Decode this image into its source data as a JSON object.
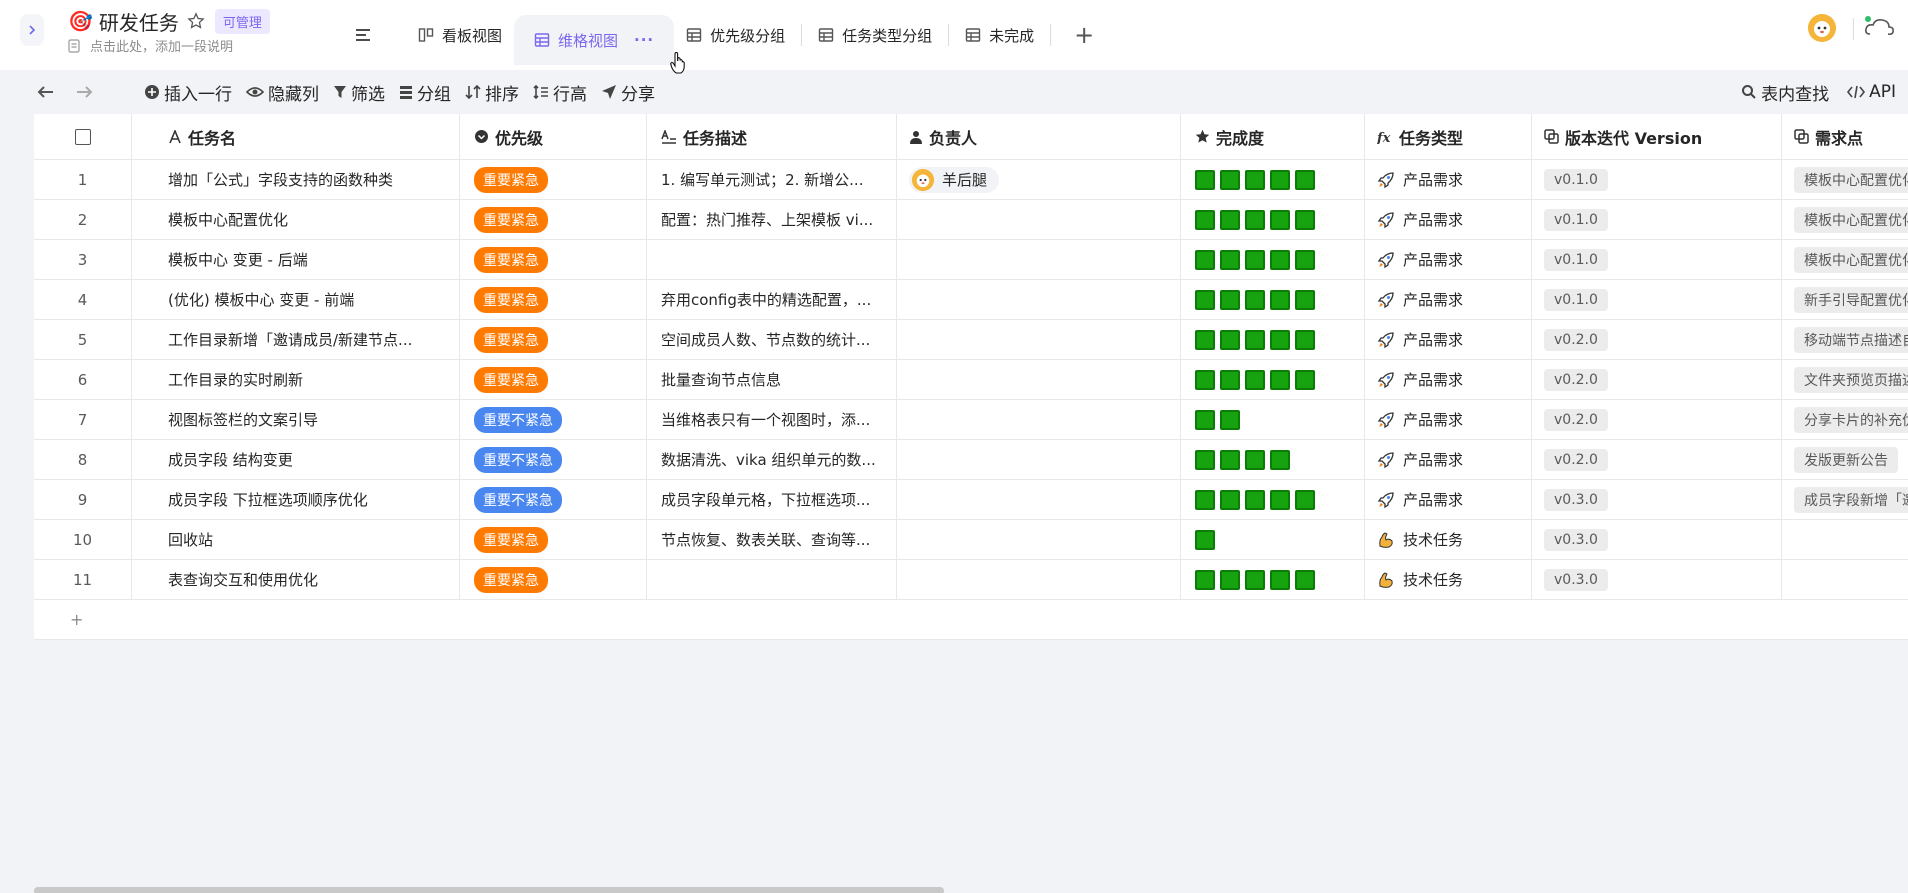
{
  "header": {
    "title_emoji": "🎯",
    "title": "研发任务",
    "permission_badge": "可管理",
    "description_placeholder": "点击此处，添加一段说明",
    "expand_icon": "chevron-right-icon"
  },
  "tabs": [
    {
      "label": "看板视图",
      "icon": "kanban-icon",
      "active": false
    },
    {
      "label": "维格视图",
      "icon": "grid-icon",
      "active": true,
      "more": "···"
    },
    {
      "label": "优先级分组",
      "icon": "grid-icon",
      "active": false
    },
    {
      "label": "任务类型分组",
      "icon": "grid-icon",
      "active": false
    },
    {
      "label": "未完成",
      "icon": "grid-icon",
      "active": false
    }
  ],
  "add_tab": "+",
  "toolbar": {
    "insert_row": "插入一行",
    "hide_columns": "隐藏列",
    "filter": "筛选",
    "group": "分组",
    "sort": "排序",
    "row_height": "行高",
    "share": "分享",
    "search": "表内查找",
    "api": "API"
  },
  "columns": {
    "name": "任务名",
    "priority": "优先级",
    "description": "任务描述",
    "owner": "负责人",
    "completion": "完成度",
    "task_type": "任务类型",
    "version": "版本迭代 Version",
    "requirement": "需求点"
  },
  "rows": [
    {
      "index": "1",
      "name": "增加「公式」字段支持的函数种类",
      "priority": "重要紧急",
      "priority_color": "orange",
      "description": "1. 编写单元测试；2. 新增公...",
      "owner": "羊后腿",
      "completion": 5,
      "type": "产品需求",
      "type_icon": "rocket-icon",
      "version": "v0.1.0",
      "requirement": "模板中心配置优化"
    },
    {
      "index": "2",
      "name": "模板中心配置优化",
      "priority": "重要紧急",
      "priority_color": "orange",
      "description": "配置：热门推荐、上架模板 vi...",
      "owner": "",
      "completion": 5,
      "type": "产品需求",
      "type_icon": "rocket-icon",
      "version": "v0.1.0",
      "requirement": "模板中心配置优化"
    },
    {
      "index": "3",
      "name": "模板中心 变更 - 后端",
      "priority": "重要紧急",
      "priority_color": "orange",
      "description": "",
      "owner": "",
      "completion": 5,
      "type": "产品需求",
      "type_icon": "rocket-icon",
      "version": "v0.1.0",
      "requirement": "模板中心配置优化"
    },
    {
      "index": "4",
      "name": "(优化) 模板中心 变更 - 前端",
      "priority": "重要紧急",
      "priority_color": "orange",
      "description": "弃用config表中的精选配置，...",
      "owner": "",
      "completion": 5,
      "type": "产品需求",
      "type_icon": "rocket-icon",
      "version": "v0.1.0",
      "requirement": "新手引导配置优化"
    },
    {
      "index": "5",
      "name": "工作目录新增「邀请成员/新建节点...",
      "priority": "重要紧急",
      "priority_color": "orange",
      "description": "空间成员人数、节点数的统计...",
      "owner": "",
      "completion": 5,
      "type": "产品需求",
      "type_icon": "rocket-icon",
      "version": "v0.2.0",
      "requirement": "移动端节点描述自动"
    },
    {
      "index": "6",
      "name": "工作目录的实时刷新",
      "priority": "重要紧急",
      "priority_color": "orange",
      "description": "批量查询节点信息",
      "owner": "",
      "completion": 5,
      "type": "产品需求",
      "type_icon": "rocket-icon",
      "version": "v0.2.0",
      "requirement": "文件夹预览页描述模"
    },
    {
      "index": "7",
      "name": "视图标签栏的文案引导",
      "priority": "重要不紧急",
      "priority_color": "blue",
      "description": "当维格表只有一个视图时，添...",
      "owner": "",
      "completion": 2,
      "type": "产品需求",
      "type_icon": "rocket-icon",
      "version": "v0.2.0",
      "requirement": "分享卡片的补充优化"
    },
    {
      "index": "8",
      "name": "成员字段 结构变更",
      "priority": "重要不紧急",
      "priority_color": "blue",
      "description": "数据清洗、vika 组织单元的数...",
      "owner": "",
      "completion": 4,
      "type": "产品需求",
      "type_icon": "rocket-icon",
      "version": "v0.2.0",
      "requirement": "发版更新公告"
    },
    {
      "index": "9",
      "name": "成员字段 下拉框选项顺序优化",
      "priority": "重要不紧急",
      "priority_color": "blue",
      "description": "成员字段单元格，下拉框选项...",
      "owner": "",
      "completion": 5,
      "type": "产品需求",
      "type_icon": "rocket-icon",
      "version": "v0.3.0",
      "requirement": "成员字段新增「邀请"
    },
    {
      "index": "10",
      "name": "回收站",
      "priority": "重要紧急",
      "priority_color": "orange",
      "description": "节点恢复、数表关联、查询等...",
      "owner": "",
      "completion": 1,
      "type": "技术任务",
      "type_icon": "muscle-icon",
      "version": "v0.3.0",
      "requirement": ""
    },
    {
      "index": "11",
      "name": "表查询交互和使用优化",
      "priority": "重要紧急",
      "priority_color": "orange",
      "description": "",
      "owner": "",
      "completion": 5,
      "type": "技术任务",
      "type_icon": "muscle-icon",
      "version": "v0.3.0",
      "requirement": ""
    }
  ],
  "add_row": "+",
  "colors": {
    "accent": "#7b67ee",
    "priority_orange": "#ff7a00",
    "priority_blue": "#4a86f0",
    "completion_green": "#16a30f"
  }
}
